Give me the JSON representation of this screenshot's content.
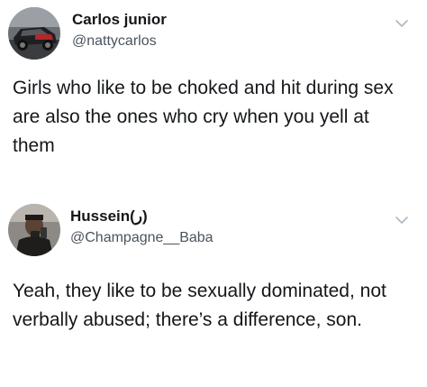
{
  "tweets": [
    {
      "author": {
        "name": "Carlos junior",
        "handle": "@nattycarlos"
      },
      "text": "Girls who like to be choked and hit during sex are also the ones who cry when you yell at them",
      "icons": {
        "avatar": "profile-photo-car",
        "menu": "chevron-down-icon"
      }
    },
    {
      "author": {
        "name": "Hussein(ر)",
        "handle": "@Champagne__Baba"
      },
      "text": "Yeah, they like to be sexually dominated, not verbally abused; there’s a difference, son.",
      "icons": {
        "avatar": "profile-photo-person",
        "menu": "chevron-down-icon"
      }
    }
  ],
  "colors": {
    "text": "#14171a",
    "handle": "#4a545e",
    "caret": "#aab8c2",
    "background": "#ffffff"
  }
}
